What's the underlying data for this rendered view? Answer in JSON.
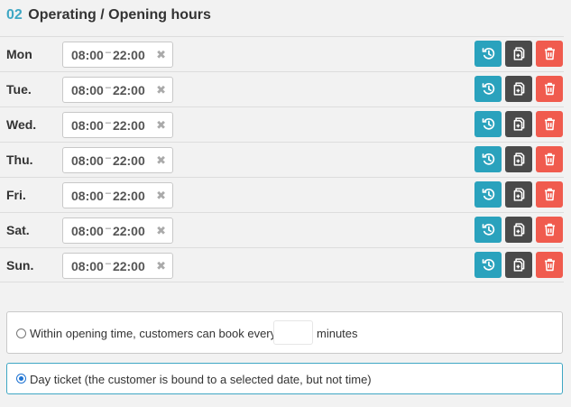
{
  "section": {
    "number": "02",
    "title": "Operating / Opening hours"
  },
  "days": [
    {
      "label": "Mon",
      "open": "08:00",
      "close": "22:00"
    },
    {
      "label": "Tue.",
      "open": "08:00",
      "close": "22:00"
    },
    {
      "label": "Wed.",
      "open": "08:00",
      "close": "22:00"
    },
    {
      "label": "Thu.",
      "open": "08:00",
      "close": "22:00"
    },
    {
      "label": "Fri.",
      "open": "08:00",
      "close": "22:00"
    },
    {
      "label": "Sat.",
      "open": "08:00",
      "close": "22:00"
    },
    {
      "label": "Sun.",
      "open": "08:00",
      "close": "22:00"
    }
  ],
  "time_separator": "–",
  "remove_glyph": "✖",
  "buttons": {
    "add_time_icon": "clock-add-icon",
    "copy_icon": "copy-icon",
    "delete_icon": "trash-icon",
    "colors": {
      "add_time": "#2aa2bd",
      "copy": "#4a4a4a",
      "delete": "#f05b4e"
    }
  },
  "booking": {
    "interval_option": {
      "prefix": "Within opening time, customers can book every",
      "value": "",
      "suffix": "minutes",
      "selected": false
    },
    "day_ticket_option": {
      "label": "Day ticket (the customer is bound to a selected date, but not time)",
      "selected": true
    }
  },
  "colors": {
    "accent": "#3fa7c4",
    "radio_selected": "#1e73d2"
  }
}
